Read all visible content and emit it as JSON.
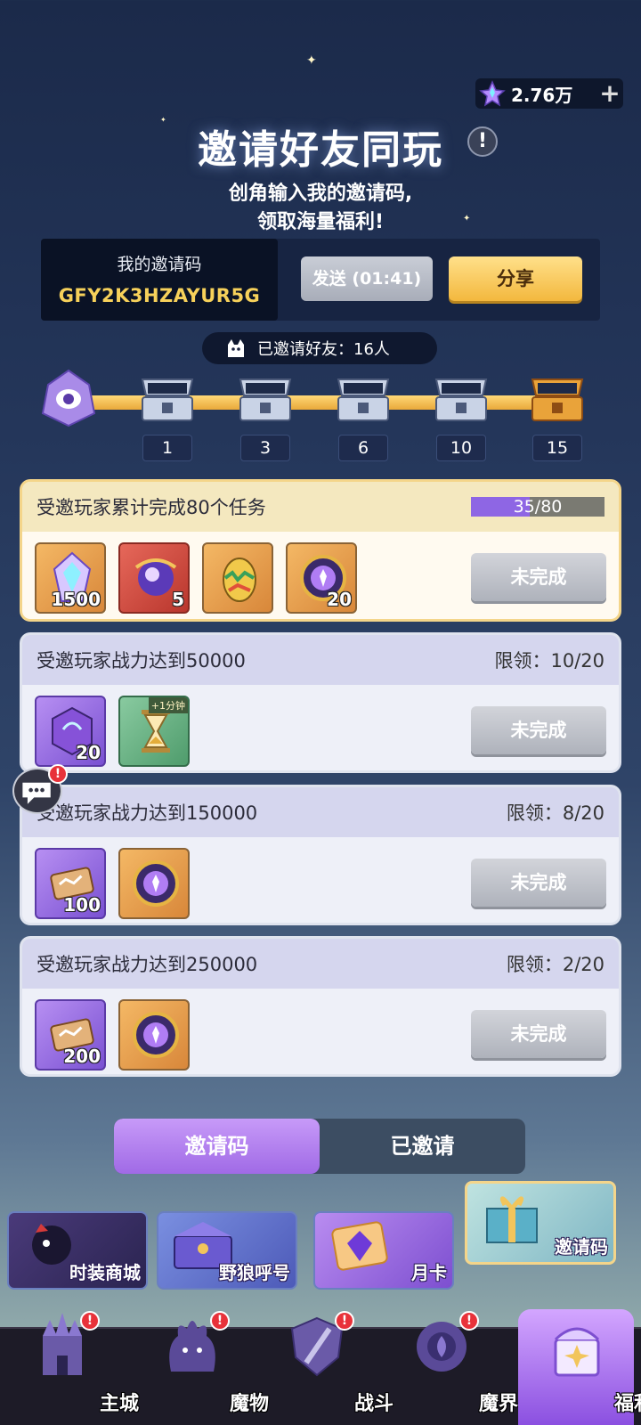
{
  "currency": {
    "value": "2.76万",
    "plus": "+",
    "icon": "star-gem-icon"
  },
  "header": {
    "title": "邀请好友同玩",
    "help": "!",
    "subtitle_line1": "创角输入我的邀请码,",
    "subtitle_line2": "领取海量福利!"
  },
  "invite": {
    "label": "我的邀请码",
    "code": "GFY2K3HZAYUR5G",
    "send_label": "发送 (01:41)",
    "share_label": "分享"
  },
  "invited": {
    "text": "已邀请好友：16人"
  },
  "milestones": [
    "1",
    "3",
    "6",
    "10",
    "15"
  ],
  "tasks": [
    {
      "desc": "受邀玩家累计完成80个任务",
      "progress_text": "35/80",
      "progress": 0.4375,
      "button": "未完成",
      "rewards": [
        {
          "qty": "1500",
          "color": "orange",
          "icon": "crystal-icon"
        },
        {
          "qty": "5",
          "color": "red",
          "icon": "orb-icon"
        },
        {
          "qty": "",
          "color": "orange",
          "icon": "egg-icon"
        },
        {
          "qty": "20",
          "color": "orange",
          "icon": "medal-icon"
        }
      ]
    },
    {
      "desc": "受邀玩家战力达到50000",
      "limit": "限领：10/20",
      "button": "未完成",
      "rewards": [
        {
          "qty": "20",
          "color": "purple",
          "icon": "rune-stone-icon"
        },
        {
          "qty": "",
          "color": "green",
          "icon": "hourglass-icon",
          "tag": "+1分钟"
        }
      ]
    },
    {
      "desc": "受邀玩家战力达到150000",
      "limit": "限领：8/20",
      "button": "未完成",
      "rewards": [
        {
          "qty": "100",
          "color": "purple",
          "icon": "scroll-icon"
        },
        {
          "qty": "",
          "color": "orange",
          "icon": "medal-icon"
        }
      ]
    },
    {
      "desc": "受邀玩家战力达到250000",
      "limit": "限领：2/20",
      "button": "未完成",
      "rewards": [
        {
          "qty": "200",
          "color": "purple",
          "icon": "scroll-icon"
        },
        {
          "qty": "",
          "color": "orange",
          "icon": "medal-icon"
        }
      ]
    }
  ],
  "tabs": {
    "active": "邀请码",
    "inactive": "已邀请"
  },
  "features": [
    "时装商城",
    "野狼呼号",
    "月卡",
    "邀请码"
  ],
  "nav": [
    "主城",
    "魔物",
    "战斗",
    "魔界",
    "福利"
  ],
  "colors": {
    "accent": "#a06ae6",
    "gold": "#f3b83e",
    "code": "#f7d15a"
  }
}
